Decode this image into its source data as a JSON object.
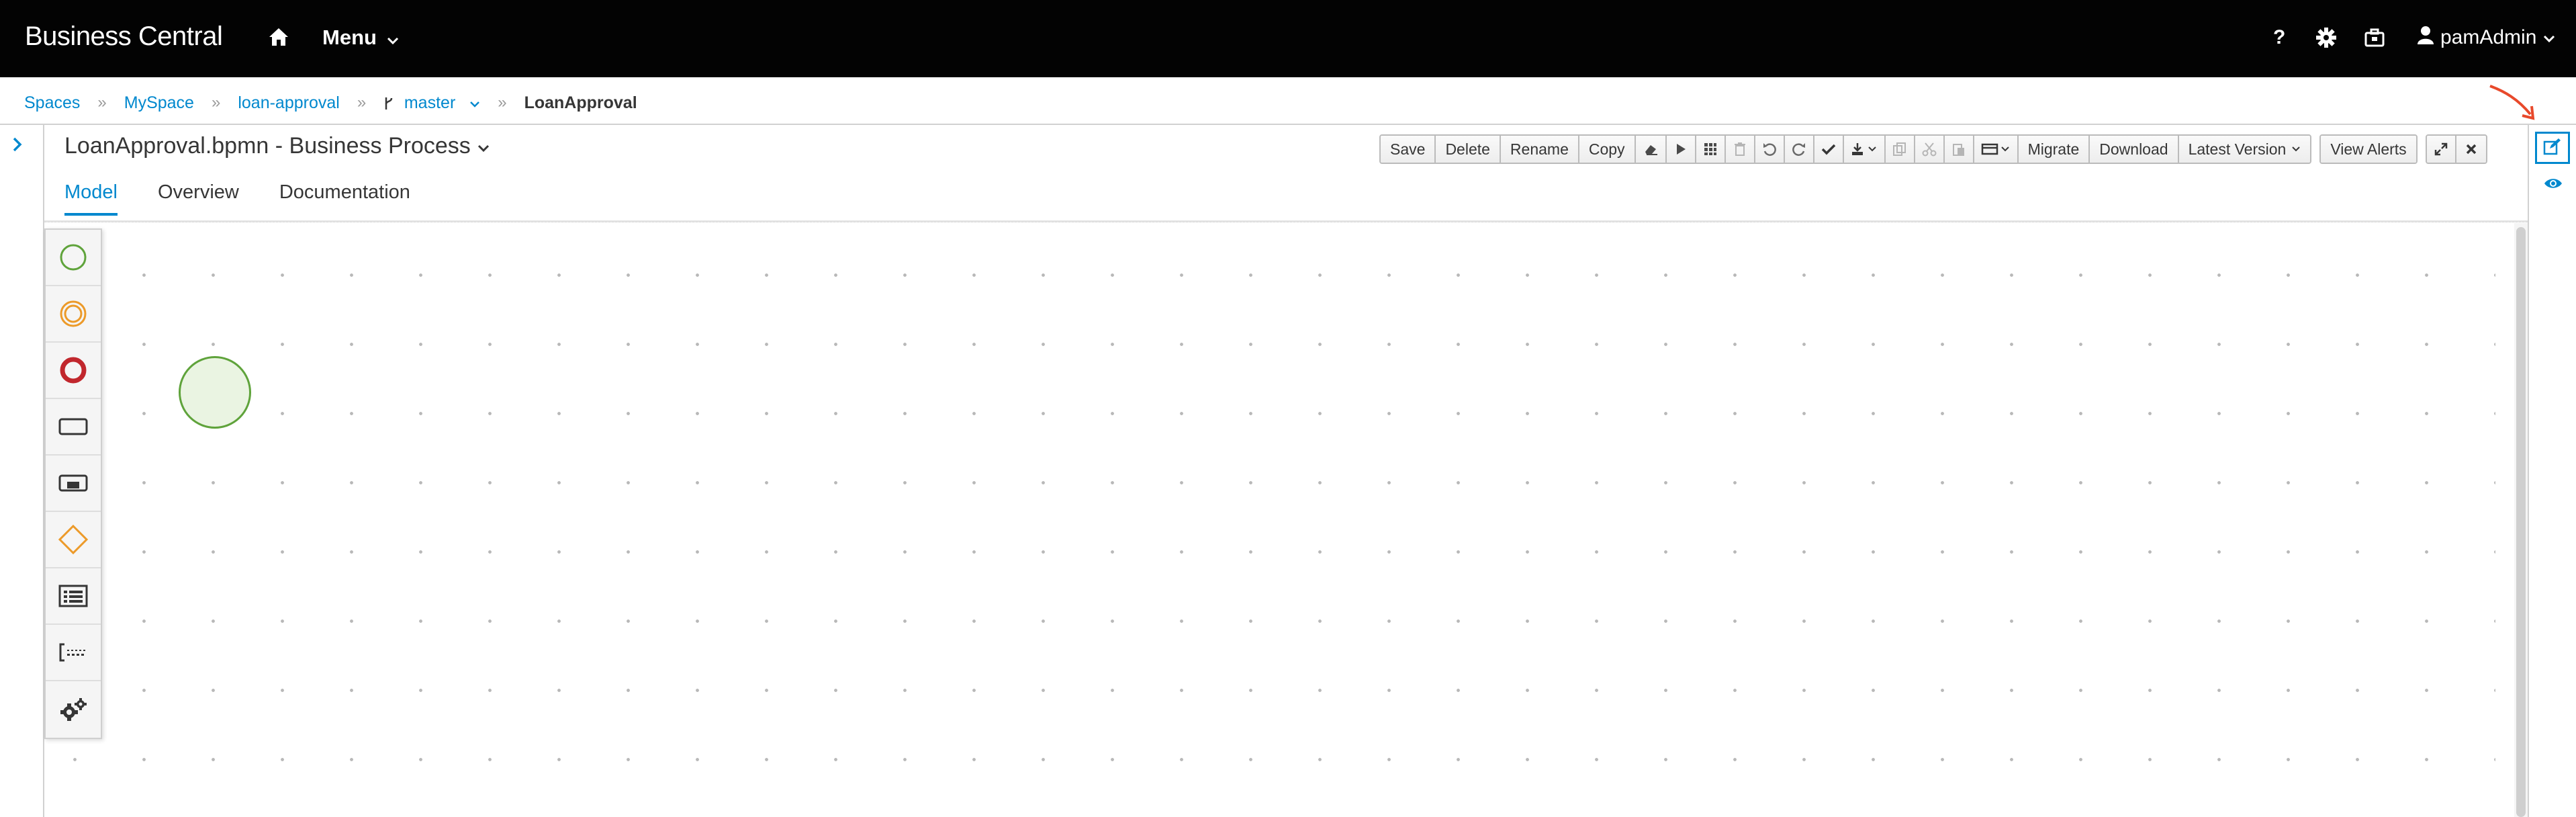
{
  "navbar": {
    "brand": "Business Central",
    "home_icon": "home-icon",
    "menu_label": "Menu",
    "help_label": "?",
    "settings_icon": "gear-icon",
    "tasks_icon": "briefcase-icon",
    "user_label": "pamAdmin"
  },
  "breadcrumb": {
    "items": [
      "Spaces",
      "MySpace",
      "loan-approval",
      "master",
      "LoanApproval"
    ],
    "separator": "»"
  },
  "editor": {
    "title": "LoanApproval.bpmn - Business Process",
    "tabs": [
      "Model",
      "Overview",
      "Documentation"
    ],
    "active_tab": "Model"
  },
  "toolbar": {
    "save": "Save",
    "delete": "Delete",
    "rename": "Rename",
    "copy": "Copy",
    "migrate": "Migrate",
    "download": "Download",
    "latest_version": "Latest Version",
    "view_alerts": "View Alerts"
  },
  "palette": {
    "items": [
      "start-event-icon",
      "intermediate-event-icon",
      "end-event-icon",
      "task-icon",
      "subprocess-icon",
      "gateway-icon",
      "lane-icon",
      "artifact-icon",
      "custom-tasks-icon"
    ]
  },
  "colors": {
    "accent": "#0088ce",
    "navbar_bg": "#030303",
    "start_green": "#5fa33b",
    "intermediate_orange": "#ec9a29",
    "end_red": "#c1272d",
    "gateway_orange": "#ec9a29",
    "annotation_arrow": "#e8492b"
  }
}
